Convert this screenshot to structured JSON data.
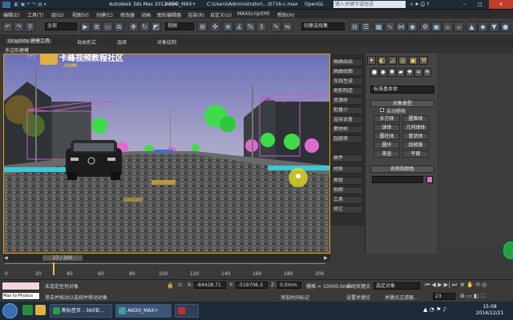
{
  "window": {
    "title_app": "Autodesk 3ds Max  2012 x64",
    "title_file": "AKOO_MAX+",
    "title_path": "C:\\Users\\Administrator\\...\\0716-c.max",
    "title_renderer": "OpenGL",
    "search_placeholder": "键入关键字或短语"
  },
  "menus": [
    "编辑(E)",
    "工具(T)",
    "组(G)",
    "视图(V)",
    "创建(C)",
    "修改器",
    "动画",
    "图形编辑器",
    "渲染(R)",
    "自定义(U)",
    "MAXScript(M)",
    "帮助(H)"
  ],
  "toolbar": {
    "selection_filter": "全部",
    "reference_coord": "视图",
    "named_selection": "创建选择集"
  },
  "ribbon": {
    "tabs": [
      "Graphite 建模工具",
      "自由形式",
      "选择",
      "对象绘制"
    ],
    "sub_label": "多边形建模"
  },
  "viewport": {
    "watermark_cn": "卡峰视频教程社区",
    "watermark_domain": ".COM"
  },
  "layout_strip": [
    "画曲线出",
    "画曲线面",
    "车线生成",
    "地形制造",
    "资源命",
    "批量小",
    "渲染设置",
    "素材树",
    "超级修",
    "插件",
    "材质",
    "表现",
    "贴图",
    "工具",
    "其它"
  ],
  "command_panel": {
    "std_primitives": "标准基本体",
    "object_type_header": "对象类型",
    "autogrid": "自动栅格",
    "object_buttons": [
      "长方体",
      "圆锥体",
      "球体",
      "几何球体",
      "圆柱体",
      "管状体",
      "圆环",
      "四棱锥",
      "茶壶",
      "平面"
    ],
    "name_color_header": "名称和颜色"
  },
  "timeline": {
    "frame_counter": "23 / 200",
    "ticks": [
      "0",
      "20",
      "40",
      "60",
      "80",
      "100",
      "120",
      "140",
      "160",
      "180",
      "200"
    ]
  },
  "status": {
    "maxscript_label": "Max to Physics",
    "selected_text": "未选定任何对象",
    "prompt_text": "单击并拖动以选择并移动对象",
    "x_label": "X:",
    "x_value": "-84428.71",
    "y_label": "Y:",
    "y_value": "-519706.3",
    "z_label": "Z:",
    "z_value": "0.0mm",
    "grid_text": "栅格 = 10000.0mm",
    "add_time_tag": "添加时间标记",
    "auto_key": "自动关键点",
    "set_key": "设置关键点",
    "key_mode": "选定对象",
    "key_filters": "关键点过滤器...",
    "frame_field": "23"
  },
  "taskbar": {
    "items": [
      {
        "label": "新标签页 - 360安..."
      },
      {
        "label": "AKOO_MAX+"
      },
      {
        "label": ""
      }
    ],
    "clock_time": "15:08",
    "clock_date": "2014/12/21"
  },
  "colors": {
    "accent_yellow": "#f0c040",
    "viewport_border": "#e6a000",
    "panel_bg": "#444444",
    "taskbar_bg": "#1d2a3a"
  }
}
